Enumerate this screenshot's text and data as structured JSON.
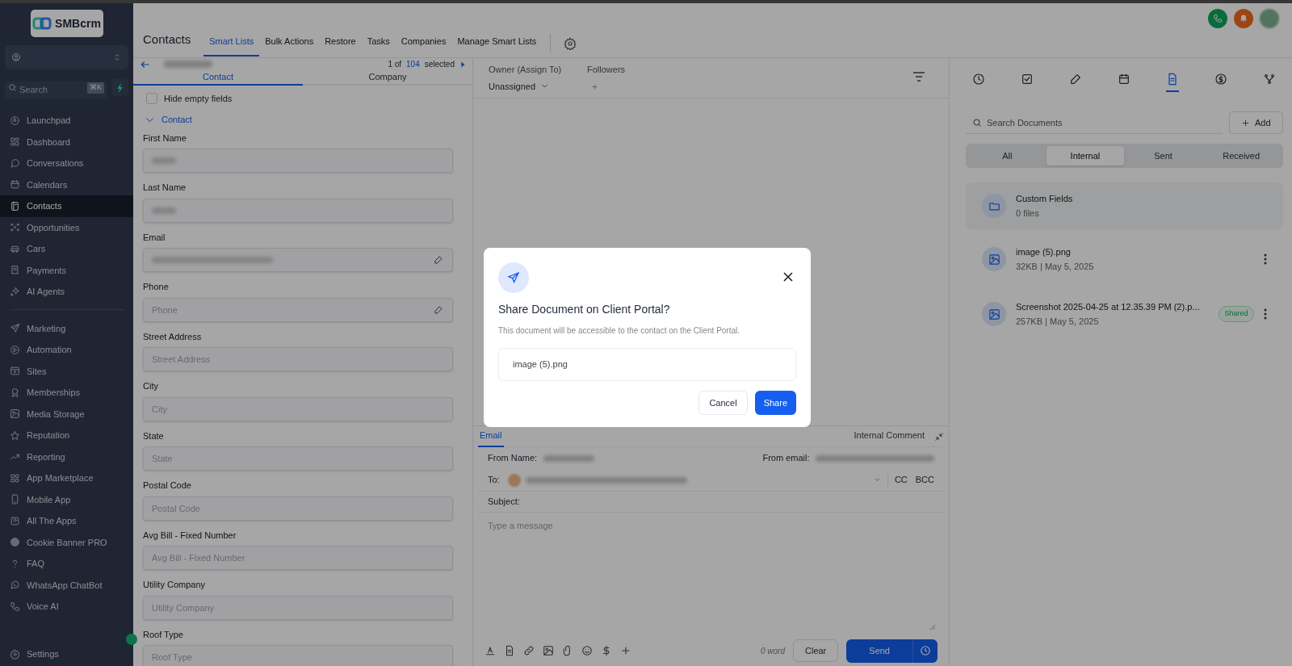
{
  "sidebar": {
    "logo": "SMBcrm",
    "search": {
      "placeholder": "Search",
      "shortcut": "⌘K"
    },
    "sections": [
      {
        "items": [
          {
            "label": "Launchpad",
            "selected": false
          },
          {
            "label": "Dashboard",
            "selected": false
          },
          {
            "label": "Conversations",
            "selected": false
          },
          {
            "label": "Calendars",
            "selected": false
          },
          {
            "label": "Contacts",
            "selected": true
          },
          {
            "label": "Opportunities",
            "selected": false
          },
          {
            "label": "Cars",
            "selected": false
          },
          {
            "label": "Payments",
            "selected": false
          },
          {
            "label": "AI Agents",
            "selected": false
          }
        ]
      },
      {
        "items": [
          {
            "label": "Marketing",
            "selected": false
          },
          {
            "label": "Automation",
            "selected": false
          },
          {
            "label": "Sites",
            "selected": false
          },
          {
            "label": "Memberships",
            "selected": false
          },
          {
            "label": "Media Storage",
            "selected": false
          },
          {
            "label": "Reputation",
            "selected": false
          },
          {
            "label": "Reporting",
            "selected": false
          },
          {
            "label": "App Marketplace",
            "selected": false
          },
          {
            "label": "Mobile App",
            "selected": false
          },
          {
            "label": "All The Apps",
            "selected": false
          },
          {
            "label": "Cookie Banner PRO",
            "selected": false
          },
          {
            "label": "FAQ",
            "selected": false
          },
          {
            "label": "WhatsApp ChatBot",
            "selected": false
          },
          {
            "label": "Voice AI",
            "selected": false
          }
        ]
      }
    ],
    "footer_item": {
      "label": "Settings"
    }
  },
  "header": {
    "title": "Contacts",
    "tabs": [
      {
        "label": "Smart Lists",
        "selected": true
      },
      {
        "label": "Bulk Actions",
        "selected": false
      },
      {
        "label": "Restore",
        "selected": false
      },
      {
        "label": "Tasks",
        "selected": false
      },
      {
        "label": "Companies",
        "selected": false
      },
      {
        "label": "Manage Smart Lists",
        "selected": false
      }
    ]
  },
  "record_nav": {
    "position": "1 of",
    "count": "104",
    "suffix": "selected"
  },
  "owner": {
    "label": "Owner (Assign To)",
    "value": "Unassigned"
  },
  "followers": {
    "label": "Followers",
    "add": "+"
  },
  "detail_tabs": [
    {
      "label": "Contact",
      "selected": true
    },
    {
      "label": "Company",
      "selected": false
    }
  ],
  "hide_empty": {
    "label": "Hide empty fields",
    "checked": false
  },
  "section": {
    "label": "Contact",
    "expanded": true
  },
  "fields": [
    {
      "label": "First Name",
      "blurred": true,
      "editable": false
    },
    {
      "label": "Last Name",
      "blurred": true,
      "editable": false
    },
    {
      "label": "Email",
      "blurred": true,
      "editable": true
    },
    {
      "label": "Phone",
      "placeholder": "Phone",
      "blurred": false,
      "editable": true
    },
    {
      "label": "Street Address",
      "placeholder": "Street Address",
      "blurred": false,
      "editable": false
    },
    {
      "label": "City",
      "placeholder": "City",
      "blurred": false,
      "editable": false
    },
    {
      "label": "State",
      "placeholder": "State",
      "blurred": false,
      "editable": false
    },
    {
      "label": "Postal Code",
      "placeholder": "Postal Code",
      "blurred": false,
      "editable": false
    },
    {
      "label": "Avg Bill - Fixed Number",
      "placeholder": "Avg Bill - Fixed Number",
      "blurred": false,
      "editable": false
    },
    {
      "label": "Utility Company",
      "placeholder": "Utility Company",
      "blurred": false,
      "editable": false
    },
    {
      "label": "Roof Type",
      "placeholder": "Roof Type",
      "blurred": false,
      "editable": false
    }
  ],
  "composer": {
    "tabs": [
      {
        "label": "Email",
        "selected": true
      },
      {
        "label": "Internal Comment",
        "selected": false
      }
    ],
    "from_name_label": "From Name:",
    "from_email_label": "From email:",
    "to_label": "To:",
    "cc": "CC",
    "bcc": "BCC",
    "subject_label": "Subject:",
    "message_placeholder": "Type a message",
    "word_count": "0 word",
    "clear": "Clear",
    "send": "Send"
  },
  "right_panel": {
    "icon_tabs": [
      {
        "selected": false
      },
      {
        "selected": false
      },
      {
        "selected": false
      },
      {
        "selected": false
      },
      {
        "selected": true
      },
      {
        "selected": false
      },
      {
        "selected": false
      }
    ],
    "search_placeholder": "Search Documents",
    "add": "Add",
    "filters": [
      {
        "label": "All",
        "selected": false
      },
      {
        "label": "Internal",
        "selected": true
      },
      {
        "label": "Sent",
        "selected": false
      },
      {
        "label": "Received",
        "selected": false
      }
    ],
    "folders": [
      {
        "name": "Custom Fields",
        "count": "0 files"
      }
    ],
    "documents": [
      {
        "name": "image (5).png",
        "meta": "32KB | May 5, 2025"
      },
      {
        "name": "Screenshot 2025-04-25 at 12.35.39 PM (2).p...",
        "meta": "257KB | May 5, 2025",
        "badge": "Shared"
      }
    ]
  },
  "modal": {
    "title": "Share Document on Client Portal?",
    "description": "This document will be accessible to the contact on the Client Portal.",
    "file": "image (5).png",
    "cancel": "Cancel",
    "confirm": "Share"
  }
}
